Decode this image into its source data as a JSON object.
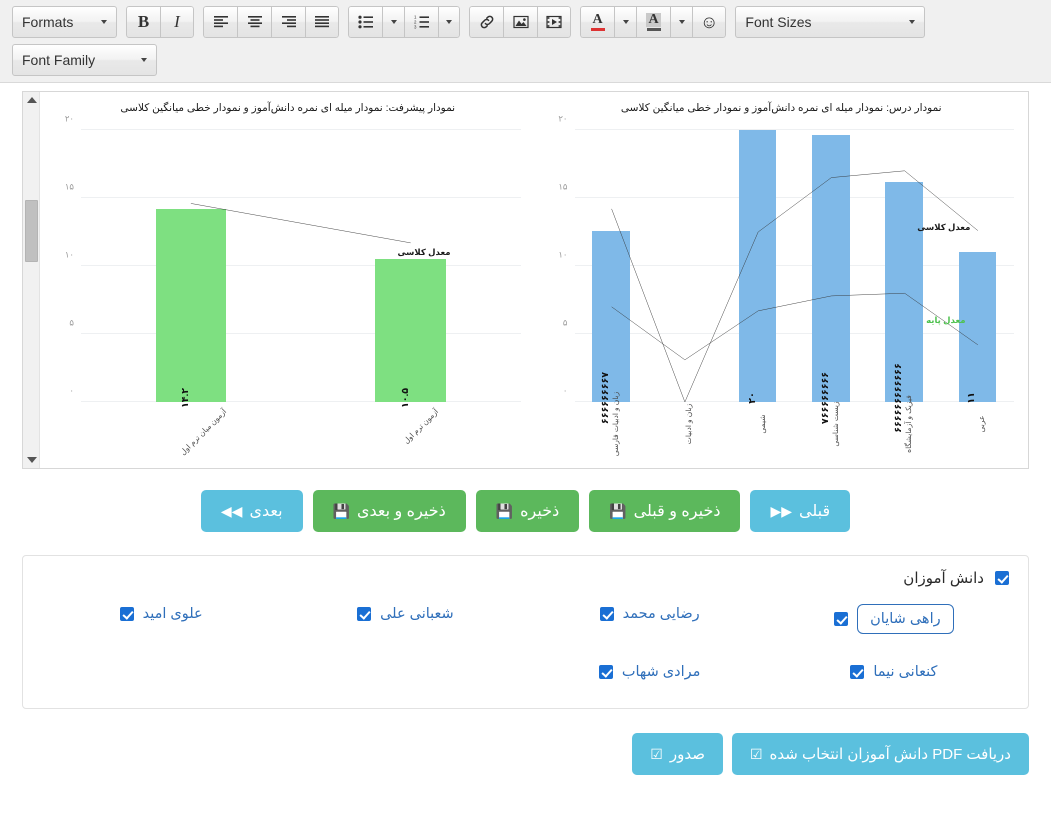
{
  "toolbar": {
    "formats_label": "Formats",
    "font_sizes_label": "Font Sizes",
    "font_family_label": "Font Family",
    "bold_label": "B",
    "italic_label": "I",
    "align_left_icon": "align-left-icon",
    "align_center_icon": "align-center-icon",
    "align_right_icon": "align-right-icon",
    "align_justify_icon": "align-justify-icon",
    "bullist_icon": "unordered-list-icon",
    "numlist_icon": "ordered-list-icon",
    "link_icon": "link-icon",
    "image_icon": "image-icon",
    "media_icon": "media-icon",
    "forecolor_label": "A",
    "backcolor_label": "A",
    "emoticon_glyph": "☺"
  },
  "chart_data": [
    {
      "type": "bar",
      "id": "progress-chart",
      "title": "نمودار پیشرفت: نمودار میله ای نمره دانش‌آموز و نمودار خطی میانگین کلاسی",
      "categories": [
        "آزمون میان ترم اول",
        "آزمون ترم اول"
      ],
      "values": [
        14.2,
        10.5
      ],
      "value_labels": [
        "۱۴.۲",
        "۱۰.۵"
      ],
      "bar_color": "#7ee081",
      "ylim": [
        0,
        20
      ],
      "yticks": [
        0,
        5,
        10,
        15,
        20
      ],
      "ytick_labels": [
        "۰",
        "۵",
        "۱۰",
        "۱۵",
        "۲۰"
      ],
      "grid": true,
      "series": [
        {
          "name": "معدل کلاسی",
          "color": "#333333",
          "values": [
            14.6,
            11.7
          ],
          "label": "معدل کلاسی"
        }
      ],
      "xlabel": "",
      "ylabel": ""
    },
    {
      "type": "bar",
      "id": "lesson-chart",
      "title": "نمودار درس: نمودار میله ای نمره دانش‌آموز و نمودار خطی میانگین کلاسی",
      "categories": [
        "زبان و ادبیات فارسی",
        "زبان و ادبیات",
        "شیمی",
        "زیست شناسی",
        "فیزیک و آزمایشگاه",
        "عربی"
      ],
      "values": [
        12.6,
        0,
        20,
        19.6,
        16.2,
        11
      ],
      "value_labels": [
        "۶۶۶۶۶۶۶۶۷",
        "",
        "۲۰",
        "۷۶۶۶۶۶۶۶۶",
        "۶۶۶۶۶۶۶۶۶۶۶۶",
        "۱۱"
      ],
      "bar_color": "#7fb9e8",
      "ylim": [
        0,
        20
      ],
      "yticks": [
        0,
        5,
        10,
        15,
        20
      ],
      "ytick_labels": [
        "۰",
        "۵",
        "۱۰",
        "۱۵",
        "۲۰"
      ],
      "grid": true,
      "series": [
        {
          "name": "معدل کلاسی",
          "color": "#333333",
          "values": [
            14.2,
            0.0,
            12.5,
            16.5,
            17.0,
            12.6
          ],
          "label": "معدل کلاسی"
        },
        {
          "name": "معدل پایه",
          "color": "#333333",
          "values": [
            7.0,
            3.1,
            6.7,
            7.8,
            8.0,
            4.2
          ],
          "label": "معدل پایه"
        }
      ],
      "xlabel": "",
      "ylabel": ""
    }
  ],
  "nav_buttons": [
    {
      "label": "قبلی",
      "glyph": "▶▶",
      "style": "blue"
    },
    {
      "label": "ذخیره و قبلی",
      "glyph": "ὋE",
      "style": "green"
    },
    {
      "label": "ذخیره",
      "glyph": "ὋE",
      "style": "green"
    },
    {
      "label": "ذخیره و بعدی",
      "glyph": "ὋE",
      "style": "green"
    },
    {
      "label": "بعدی",
      "glyph": "◀◀",
      "style": "blue"
    }
  ],
  "students_panel": {
    "header_label": "دانش آموزان",
    "header_checked": true,
    "rows": [
      [
        {
          "name": "راهی شایان",
          "checked": true,
          "selected": true
        },
        {
          "name": "رضایی محمد",
          "checked": true,
          "selected": false
        },
        {
          "name": "شعبانی علی",
          "checked": true,
          "selected": false
        },
        {
          "name": "علوی امید",
          "checked": true,
          "selected": false
        }
      ],
      [
        {
          "name": "کنعانی نیما",
          "checked": true,
          "selected": false
        },
        {
          "name": "مرادی شهاب",
          "checked": true,
          "selected": false
        },
        {
          "name": "",
          "checked": false,
          "selected": false
        },
        {
          "name": "",
          "checked": false,
          "selected": false
        }
      ]
    ]
  },
  "footer_buttons": [
    {
      "label": "دریافت PDF دانش آموزان انتخاب شده",
      "glyph": "☑",
      "style": "blue"
    },
    {
      "label": "صدور",
      "glyph": "☑",
      "style": "blue"
    }
  ],
  "colors": {
    "green_bar": "#7ee081",
    "blue_bar": "#7fb9e8",
    "btn_blue": "#5bc0de",
    "btn_green": "#5cb85c",
    "link_blue": "#2f6fba",
    "base_line_green": "#4fc24f"
  }
}
